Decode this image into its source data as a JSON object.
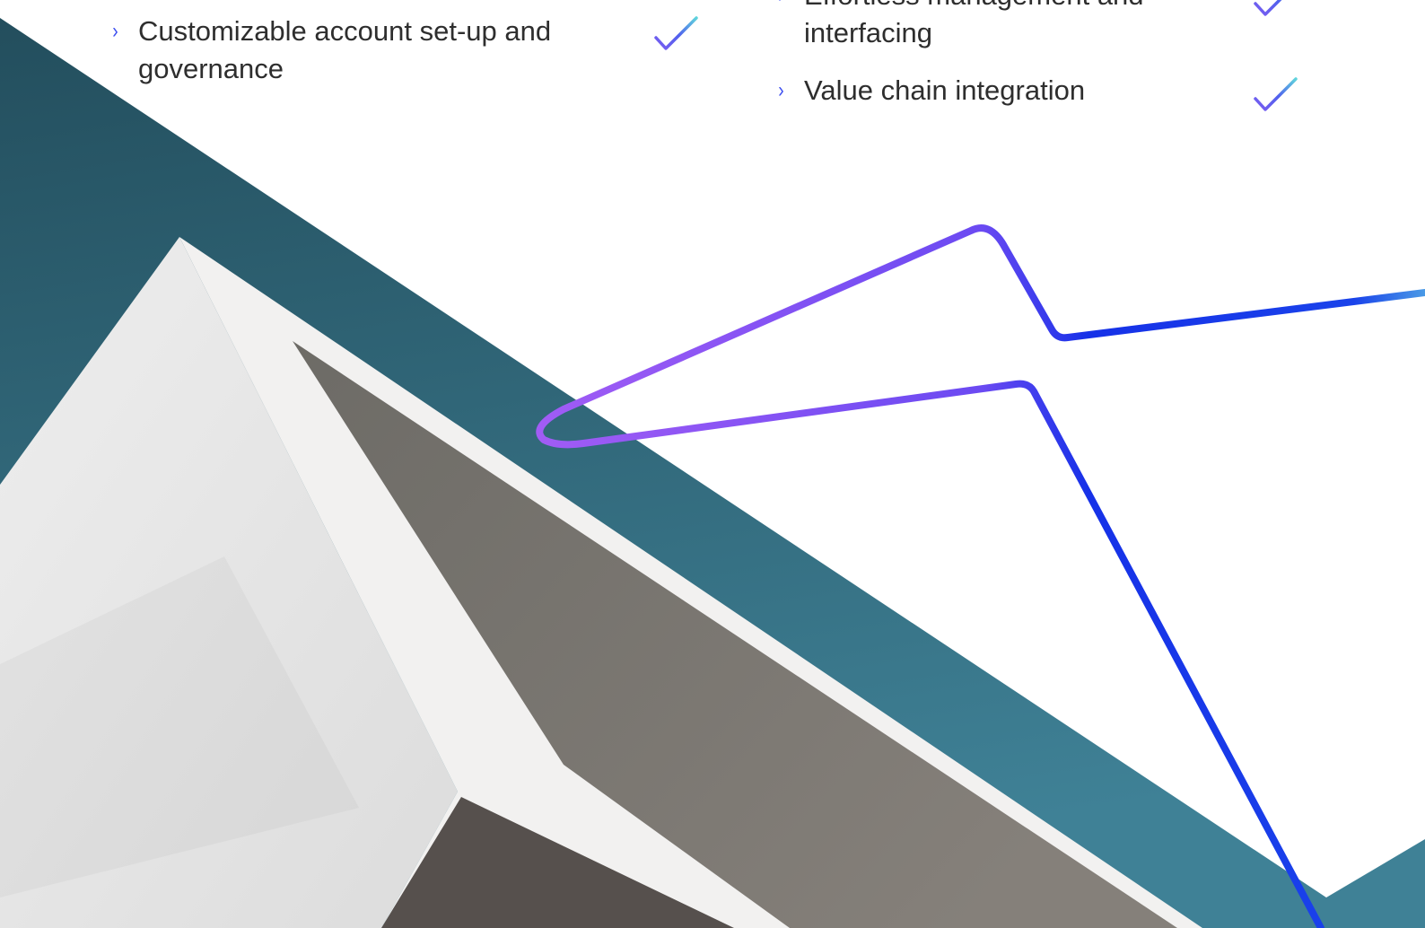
{
  "features": {
    "left": [
      {
        "label": "Customizable account set-up and governance"
      }
    ],
    "right": [
      {
        "label": "Effortless management and interfacing"
      },
      {
        "label": "Value chain integration"
      }
    ]
  },
  "icons": {
    "bullet": "chevron-right-icon",
    "status": "checkmark-icon"
  },
  "colors": {
    "text": "#2e2e2e",
    "bullet_accent": "#3c4ef0",
    "teal_band_top": "#234e5d",
    "teal_band_bottom": "#3f8196",
    "line_purple": "#a15cf5",
    "line_blue": "#1631e8",
    "check_purple": "#7b5cf0",
    "check_teal": "#5fd4dc"
  }
}
